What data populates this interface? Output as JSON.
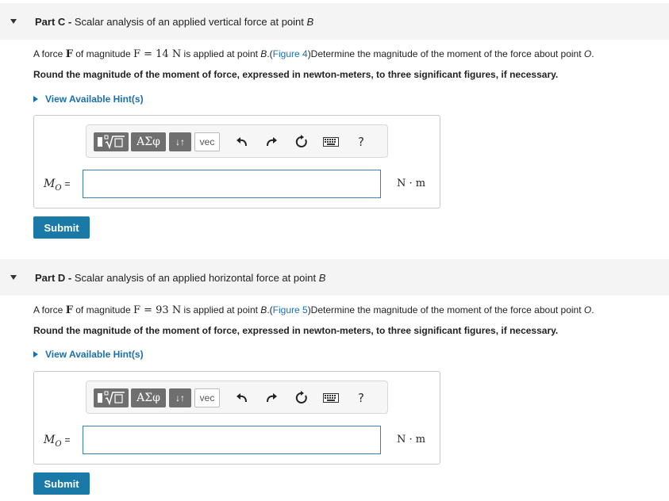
{
  "parts": [
    {
      "id": "C",
      "header_prefix": "Part C - ",
      "header_title": "Scalar analysis of an applied vertical force at point ",
      "header_point": "B",
      "prompt_pre": "A force ",
      "force_symbol": "F",
      "prompt_mid": " of magnitude ",
      "magnitude_expr": "F = 14 N",
      "prompt_post1": " is applied at point ",
      "point": "B",
      "prompt_post2": ".(",
      "figure_link": "Figure 4",
      "prompt_post3": ")Determine the magnitude of the moment of the force about point ",
      "about_point": "O",
      "prompt_end": ".",
      "round_text": "Round the magnitude of the moment of force, expressed in newton-meters, to three significant figures, if necessary.",
      "hint_label": "View Available Hint(s)",
      "variable_label": "M",
      "variable_sub": "O",
      "equals": "=",
      "input_value": "",
      "unit": "N · m",
      "submit_label": "Submit"
    },
    {
      "id": "D",
      "header_prefix": "Part D - ",
      "header_title": "Scalar analysis of an applied horizontal force at point ",
      "header_point": "B",
      "prompt_pre": "A force ",
      "force_symbol": "F",
      "prompt_mid": " of magnitude ",
      "magnitude_expr": "F = 93 N",
      "prompt_post1": " is applied at point ",
      "point": "B",
      "prompt_post2": ".(",
      "figure_link": "Figure 5",
      "prompt_post3": ")Determine the magnitude of the moment of the force about point ",
      "about_point": "O",
      "prompt_end": ".",
      "round_text": "Round the magnitude of the moment of force, expressed in newton-meters, to three significant figures, if necessary.",
      "hint_label": "View Available Hint(s)",
      "variable_label": "M",
      "variable_sub": "O",
      "equals": "=",
      "input_value": "",
      "unit": "N · m",
      "submit_label": "Submit"
    }
  ],
  "toolbar": {
    "templates_label": "▮√▭",
    "greek_label": "ΑΣφ",
    "arrows_label": "↓↑",
    "vec_label": "vec",
    "help_label": "?",
    "icons": [
      "undo-icon",
      "redo-icon",
      "reset-icon",
      "keyboard-icon",
      "help-icon"
    ]
  },
  "colors": {
    "link": "#1a6fb0",
    "submit_bg": "#1b79a8",
    "header_bg": "#f4f4f4",
    "input_border": "#3a7fb8"
  }
}
